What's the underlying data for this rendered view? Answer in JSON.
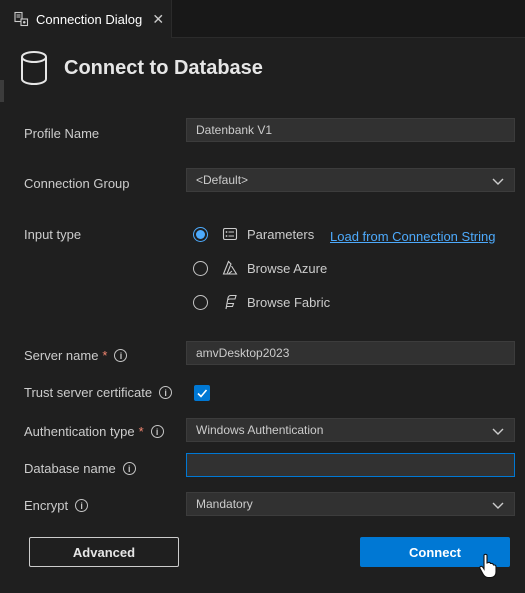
{
  "tab": {
    "title": "Connection Dialog",
    "close_glyph": "✕",
    "icon": "connection-dialog-icon"
  },
  "header": {
    "title": "Connect to Database",
    "icon": "database-icon"
  },
  "form": {
    "profile_name": {
      "label": "Profile Name",
      "value": "Datenbank V1"
    },
    "connection_group": {
      "label": "Connection Group",
      "value": "<Default>"
    },
    "input_type": {
      "label": "Input type",
      "options": [
        {
          "label": "Parameters",
          "icon": "parameters-icon",
          "selected": true
        },
        {
          "label": "Browse Azure",
          "icon": "azure-icon",
          "selected": false
        },
        {
          "label": "Browse Fabric",
          "icon": "fabric-icon",
          "selected": false
        }
      ],
      "link": "Load from Connection String"
    },
    "server_name": {
      "label": "Server name",
      "required": "*",
      "value": "amvDesktop2023"
    },
    "trust_server_certificate": {
      "label": "Trust server certificate",
      "checked": true
    },
    "authentication_type": {
      "label": "Authentication type",
      "required": "*",
      "value": "Windows Authentication"
    },
    "database_name": {
      "label": "Database name",
      "value": ""
    },
    "encrypt": {
      "label": "Encrypt",
      "value": "Mandatory"
    }
  },
  "buttons": {
    "advanced": "Advanced",
    "connect": "Connect"
  },
  "colors": {
    "accent": "#0078d4",
    "link": "#4daafc",
    "required": "#f48771",
    "background": "#1f1f1f",
    "input": "#313131"
  }
}
